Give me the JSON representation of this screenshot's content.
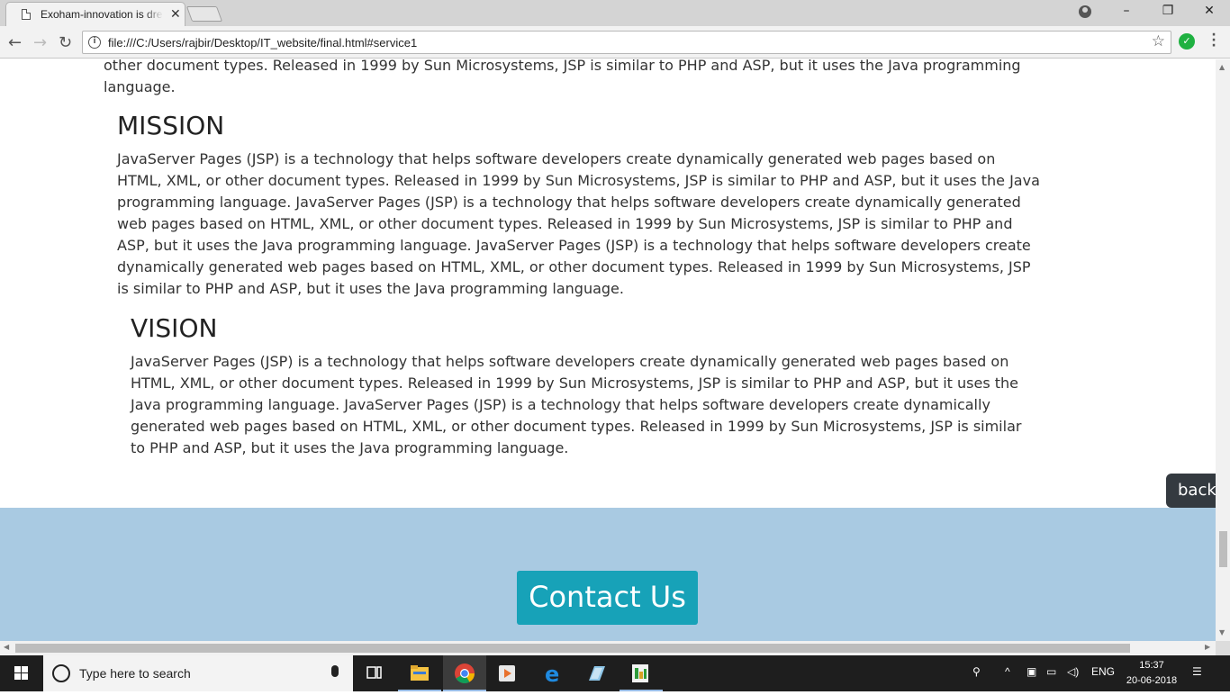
{
  "browser": {
    "tab_title": "Exoham-innovation is dre",
    "url": "file:///C:/Users/rajbir/Desktop/IT_website/final.html#service1"
  },
  "page": {
    "top_fragment": "other document types. Released in 1999 by Sun Microsystems, JSP is similar to PHP and ASP, but it uses the Java programming language.",
    "mission": {
      "heading": "MISSION",
      "text": "JavaServer Pages (JSP) is a technology that helps software developers create dynamically generated web pages based on HTML, XML, or other document types. Released in 1999 by Sun Microsystems, JSP is similar to PHP and ASP, but it uses the Java programming language. JavaServer Pages (JSP) is a technology that helps software developers create dynamically generated web pages based on HTML, XML, or other document types. Released in 1999 by Sun Microsystems, JSP is similar to PHP and ASP, but it uses the Java programming language. JavaServer Pages (JSP) is a technology that helps software developers create dynamically generated web pages based on HTML, XML, or other document types. Released in 1999 by Sun Microsystems, JSP is similar to PHP and ASP, but it uses the Java programming language."
    },
    "vision": {
      "heading": "VISION",
      "text": "JavaServer Pages (JSP) is a technology that helps software developers create dynamically generated web pages based on HTML, XML, or other document types. Released in 1999 by Sun Microsystems, JSP is similar to PHP and ASP, but it uses the Java programming language. JavaServer Pages (JSP) is a technology that helps software developers create dynamically generated web pages based on HTML, XML, or other document types. Released in 1999 by Sun Microsystems, JSP is similar to PHP and ASP, but it uses the Java programming language."
    },
    "back_button": "back",
    "contact_button": "Contact Us"
  },
  "taskbar": {
    "search_placeholder": "Type here to search",
    "language": "ENG",
    "time": "15:37",
    "date": "20-06-2018"
  },
  "colors": {
    "footer_bg": "#a9cae2",
    "contact_bg": "#17a2b8",
    "back_bg": "#343a40"
  }
}
